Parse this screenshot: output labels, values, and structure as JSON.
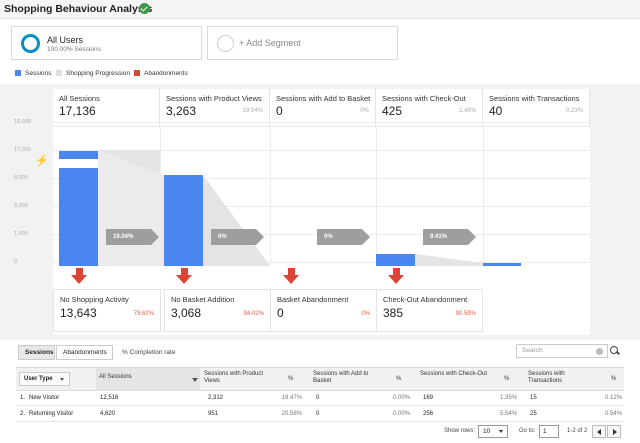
{
  "header": {
    "title": "Shopping Behaviour Analysis"
  },
  "segments": [
    {
      "name": "All Users",
      "sub": "100.00% Sessions"
    },
    {
      "name": "+ Add Segment"
    }
  ],
  "legend": [
    {
      "label": "Sessions",
      "color": "#4a86f0"
    },
    {
      "label": "Shopping Progression",
      "color": "#e0e0e0"
    },
    {
      "label": "Abandonments",
      "color": "#db4437"
    }
  ],
  "chart_data": {
    "type": "bar",
    "y_ticks": [
      "16,000",
      "17,000",
      "8,000",
      "3,000",
      "1,000",
      "0"
    ],
    "stages": [
      {
        "label": "All Sessions",
        "value": 17136,
        "display": "17,136",
        "pct": ""
      },
      {
        "label": "Sessions with Product Views",
        "value": 3263,
        "display": "3,263",
        "pct": "19.04%"
      },
      {
        "label": "Sessions with Add to Basket",
        "value": 0,
        "display": "0",
        "pct": "0%"
      },
      {
        "label": "Sessions with Check-Out",
        "value": 425,
        "display": "425",
        "pct": "2.48%"
      },
      {
        "label": "Sessions with Transactions",
        "value": 40,
        "display": "40",
        "pct": "0.23%"
      }
    ],
    "conversions": [
      "19.04%",
      "0%",
      "0%",
      "9.41%"
    ],
    "abandonments": [
      {
        "label": "No Shopping Activity",
        "value": 13643,
        "display": "13,643",
        "pct": "79.62%"
      },
      {
        "label": "No Basket Addition",
        "value": 3068,
        "display": "3,068",
        "pct": "94.02%"
      },
      {
        "label": "Basket Abandonment",
        "value": 0,
        "display": "0",
        "pct": "0%"
      },
      {
        "label": "Check-Out Abandonment",
        "value": 385,
        "display": "385",
        "pct": "90.59%"
      }
    ]
  },
  "table": {
    "tabs": [
      "Sessions",
      "Abandonments"
    ],
    "completion_rate_label": "% Completion rate",
    "search_placeholder": "Search",
    "dimension": "User Type",
    "columns": [
      "All Sessions",
      "Sessions with Product Views",
      "%",
      "Sessions with Add to Basket",
      "%",
      "Sessions with Check-Out",
      "%",
      "Sessions with Transactions",
      "%"
    ],
    "rows": [
      {
        "idx": "1.",
        "type": "New Visitor",
        "all": "12,516",
        "pv": "2,312",
        "pv_pct": "18.47%",
        "atb": "0",
        "atb_pct": "0.00%",
        "co": "169",
        "co_pct": "1.35%",
        "tx": "15",
        "tx_pct": "0.12%"
      },
      {
        "idx": "2.",
        "type": "Returning Visitor",
        "all": "4,620",
        "pv": "951",
        "pv_pct": "20.58%",
        "atb": "0",
        "atb_pct": "0.00%",
        "co": "256",
        "co_pct": "5.54%",
        "tx": "25",
        "tx_pct": "0.54%"
      }
    ],
    "pager": {
      "show_rows_label": "Show rows:",
      "rows_value": "10",
      "goto_label": "Go to:",
      "goto_value": "1",
      "range": "1-2 of 2"
    }
  }
}
